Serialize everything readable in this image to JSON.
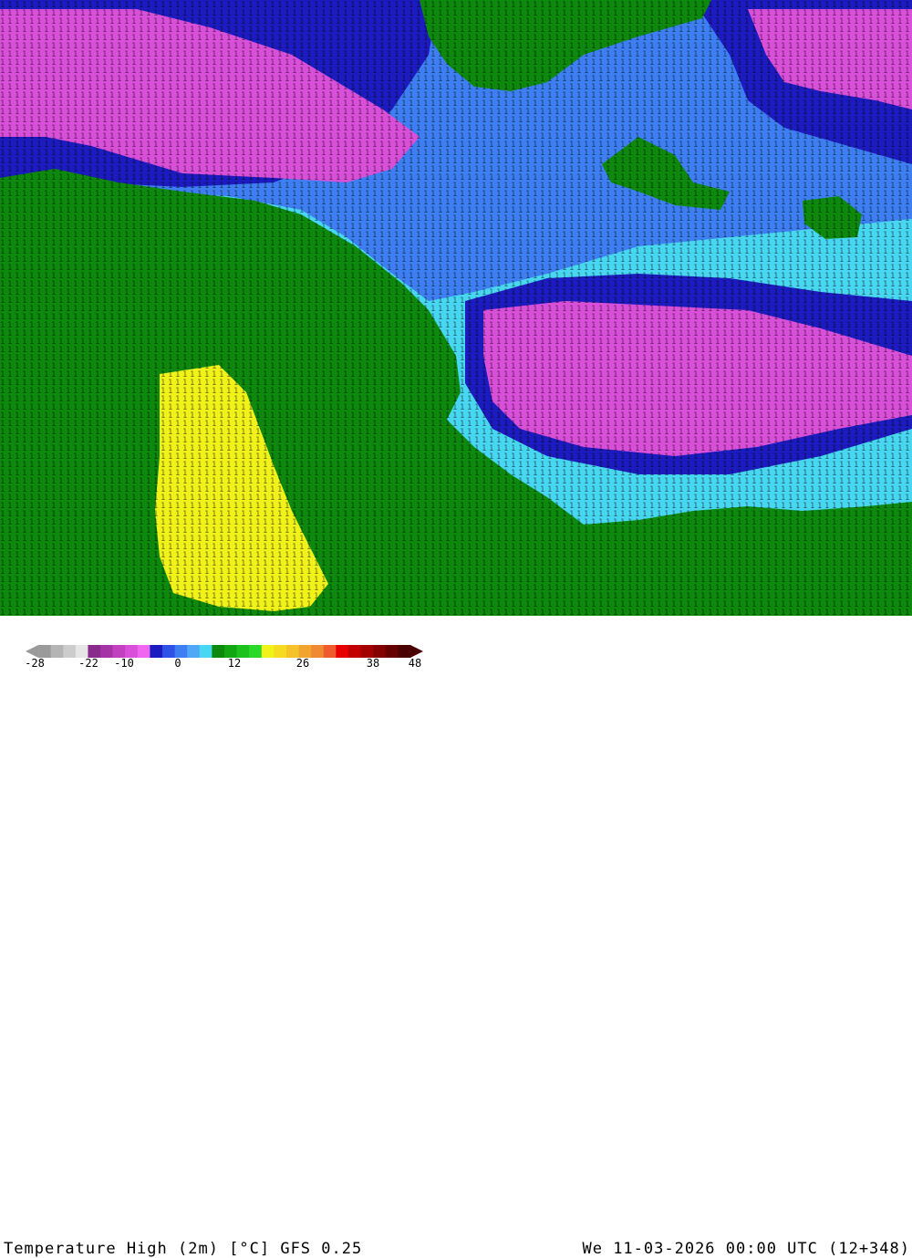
{
  "header": {
    "title": "Temperature High (2m) [°C] GFS 0.25",
    "datetime": "We 11-03-2026 00:00 UTC (12+348)"
  },
  "legend": {
    "ticks": [
      "-28",
      "-22",
      "-10",
      "0",
      "12",
      "26",
      "38",
      "48"
    ],
    "colors": [
      "#9a9a9a",
      "#b4b4b4",
      "#cccccc",
      "#e6e6e6",
      "#8a2a8a",
      "#a633a6",
      "#c040c0",
      "#d94fd9",
      "#ef66ef",
      "#1b1bbf",
      "#2e52e6",
      "#3d7ff2",
      "#4fa8f5",
      "#48d7f2",
      "#0d8a0d",
      "#13a613",
      "#1bc21b",
      "#28d928",
      "#f2f21b",
      "#f5dc22",
      "#f5c229",
      "#f2a52e",
      "#ef8a33",
      "#ef5a2e",
      "#e60000",
      "#c20000",
      "#a30000",
      "#840000",
      "#660000",
      "#4a0000"
    ]
  },
  "map": {
    "description_colors": {
      "land": "#0d8a0d",
      "ocean_warm": "#48d7f2",
      "ocean_mid": "#3d7ff2",
      "cold": "#1b1bbf",
      "very_cold": "#d94fd9",
      "hot": "#f2f21b"
    }
  }
}
